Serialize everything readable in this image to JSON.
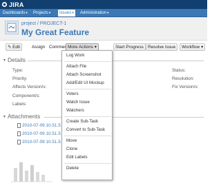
{
  "app": {
    "logo_text": "JIRA"
  },
  "nav": [
    {
      "label": "Dashboards",
      "active": false
    },
    {
      "label": "Projects",
      "active": false
    },
    {
      "label": "Issues",
      "active": true
    },
    {
      "label": "Administration",
      "active": false
    }
  ],
  "header": {
    "breadcrumb": "project / PROJECT-1",
    "title": "My Great Feature"
  },
  "toolbar": {
    "edit": "Edit",
    "assign": "Assign",
    "comment": "Comment",
    "more_actions": "More Actions",
    "start_progress": "Start Progress",
    "resolve_issue": "Resolve Issue",
    "workflow": "Workflow"
  },
  "details": {
    "title": "Details",
    "left_fields": [
      "Type:",
      "Priority:",
      "Affects Version/s:",
      "Component/s:",
      "Labels:"
    ],
    "right_fields": [
      "Status:",
      "Resolution:",
      "Fix Version/s:"
    ]
  },
  "attachments": {
    "title": "Attachments",
    "files": [
      "2010-07-09 10.51.5",
      "2010-07-09 10.51.5",
      "2010-07-09 10.51.5"
    ]
  },
  "more_actions_menu": [
    {
      "label": "Log Work",
      "group": 1
    },
    {
      "label": "Attach File",
      "group": 2
    },
    {
      "label": "Attach Screenshot",
      "group": 2
    },
    {
      "label": "Add/Edit UI Mockup",
      "group": 2,
      "highlight": true
    },
    {
      "label": "Voters",
      "group": 3
    },
    {
      "label": "Watch Issue",
      "group": 3
    },
    {
      "label": "Watchers",
      "group": 3
    },
    {
      "label": "Create Sub-Task",
      "group": 4
    },
    {
      "label": "Convert to Sub-Task",
      "group": 4
    },
    {
      "label": "Move",
      "group": 5
    },
    {
      "label": "Clone",
      "group": 5
    },
    {
      "label": "Edit Labels",
      "group": 5
    },
    {
      "label": "Delete",
      "group": 6
    }
  ],
  "colors": {
    "topbar": "#114070",
    "navbar": "#3c78b5",
    "title": "#3c78b5",
    "link": "#3c78b5"
  }
}
